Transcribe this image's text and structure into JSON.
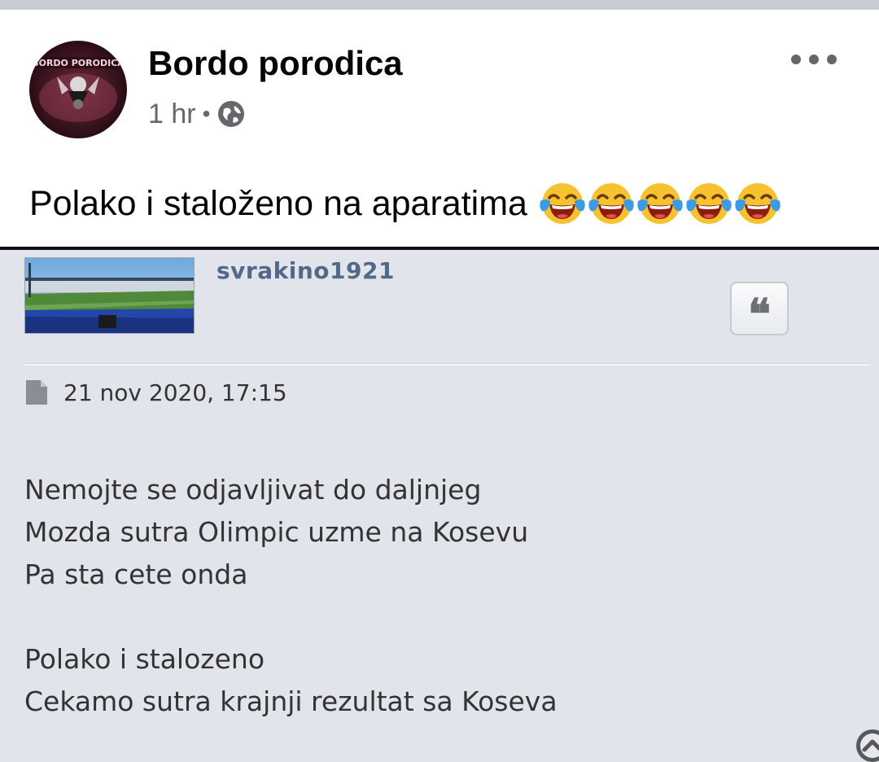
{
  "post": {
    "page_name": "Bordo porodica",
    "avatar_text": "BORDO PORODICA",
    "time": "1 hr",
    "separator": "•",
    "privacy_icon": "globe-icon",
    "more_icon": "more-options-icon",
    "caption": "Polako i staloženo na aparatima",
    "caption_emoji": [
      "face-with-tears-of-joy",
      "face-with-tears-of-joy",
      "face-with-tears-of-joy",
      "face-with-tears-of-joy",
      "face-with-tears-of-joy"
    ]
  },
  "forum": {
    "username": "svrakino1921",
    "quote_icon": "quote-icon",
    "post_icon": "document-icon",
    "date": "21 nov 2020, 17:15",
    "lines": [
      "Nemojte se odjavljivat do daljnjeg",
      "Mozda sutra Olimpic uzme na Kosevu",
      "Pa sta cete onda",
      "",
      "Polako i stalozeno",
      "Cekamo sutra krajnji rezultat sa Koseva"
    ],
    "colors": {
      "background": "#e1e4ea",
      "username": "#52698a",
      "text": "#333333"
    }
  },
  "colors": {
    "meta_text": "#65676b",
    "title": "#050505"
  }
}
